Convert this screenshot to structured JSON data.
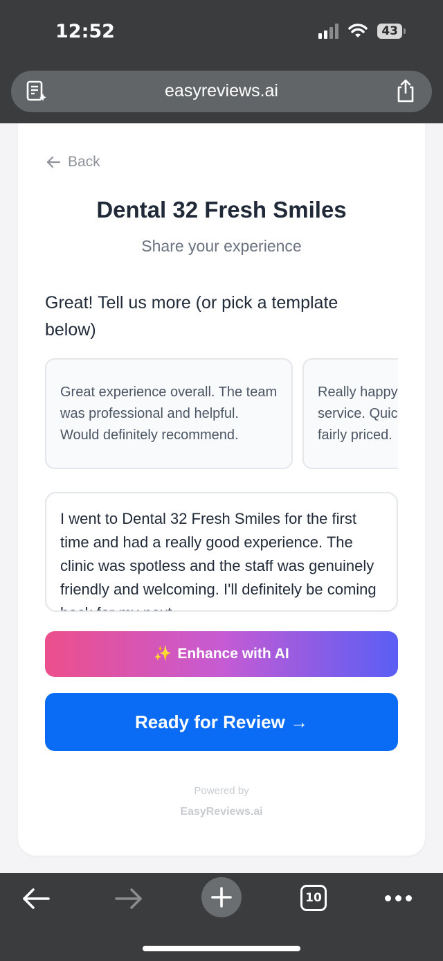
{
  "status_bar": {
    "time": "12:52",
    "battery": "43"
  },
  "browser": {
    "url": "easyreviews.ai",
    "tab_count": "10"
  },
  "page": {
    "back_label": "Back",
    "title": "Dental 32 Fresh Smiles",
    "subtitle": "Share your experience",
    "prompt": "Great! Tell us more (or pick a template below)",
    "templates": [
      "Great experience overall. The team was professional and helpful. Would definitely recommend.",
      "Really happy with the service. Quick, efficient and fairly priced."
    ],
    "review_text": "I went to Dental 32 Fresh Smiles for the first time and had a really good experience. The clinic was spotless and the staff was genuinely friendly and welcoming. I'll definitely be coming back for my next",
    "enhance_icon": "✨",
    "enhance_label": "Enhance with AI",
    "ready_label": "Ready for Review →",
    "powered_by": "Powered by",
    "brand": "EasyReviews.ai"
  },
  "colors": {
    "primary": "#0a6cf5",
    "gradient_start": "#ec4f8c",
    "gradient_end": "#5a5ef5",
    "chrome": "#3a3c3e"
  }
}
